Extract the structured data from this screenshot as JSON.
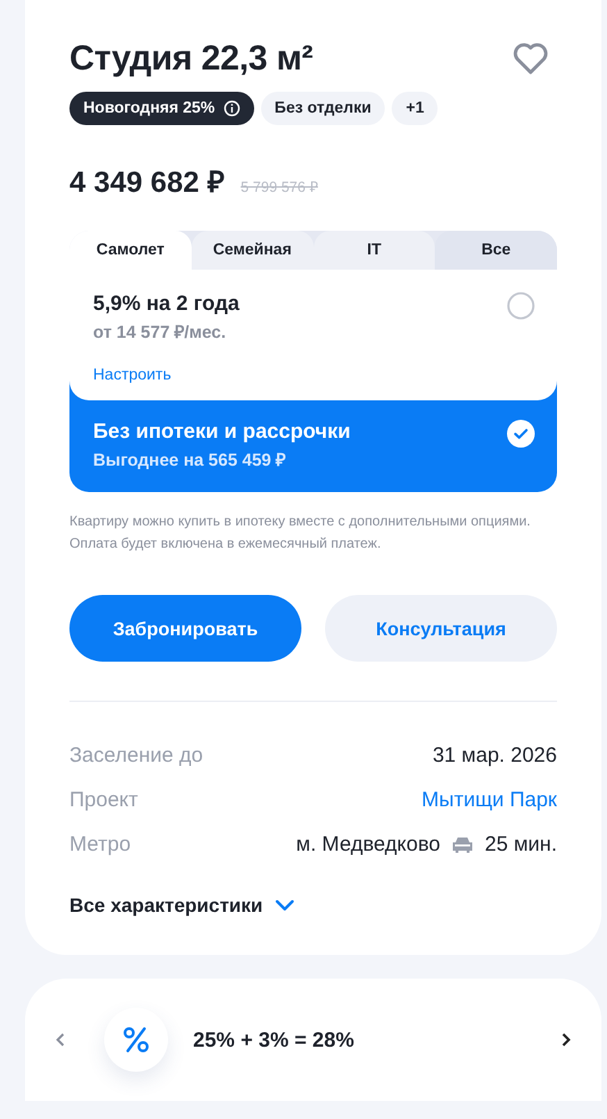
{
  "listing": {
    "title": "Студия 22,3 м²",
    "favorite": false,
    "tags": [
      {
        "label": "Новогодняя 25%",
        "kind": "promo"
      },
      {
        "label": "Без отделки",
        "kind": "plain"
      },
      {
        "label": "+1",
        "kind": "plain"
      }
    ],
    "price": "4 349 682 ₽",
    "old_price": "5 799 576 ₽",
    "tabs": [
      {
        "label": "Самолет",
        "selected": true
      },
      {
        "label": "Семейная",
        "selected": false
      },
      {
        "label": "IT",
        "selected": false
      },
      {
        "label": "Все",
        "selected": false
      }
    ],
    "options": [
      {
        "title": "5,9% на 2 года",
        "subtitle": "от 14 577 ₽/мес.",
        "link": "Настроить",
        "selected": false
      },
      {
        "title": "Без ипотеки и рассрочки",
        "subtitle": "Выгоднее на 565 459 ₽",
        "selected": true
      }
    ],
    "note": "Квартиру можно купить в ипотеку вместе с дополнительными опциями. Оплата будет включена в ежемесячный платеж.",
    "buttons": [
      {
        "label": "Забронировать",
        "kind": "primary"
      },
      {
        "label": "Консультация",
        "kind": "secondary"
      }
    ],
    "details": [
      {
        "label": "Заселение до",
        "value": "31 мар. 2026",
        "kind": "text"
      },
      {
        "label": "Проект",
        "value": "Мытищи Парк",
        "kind": "link"
      },
      {
        "label": "Метро",
        "value": "м. Медведково",
        "time": "25 мин.",
        "kind": "metro"
      }
    ],
    "all_specs": "Все характеристики"
  },
  "promo": {
    "text": "25% + 3% = 28%"
  }
}
